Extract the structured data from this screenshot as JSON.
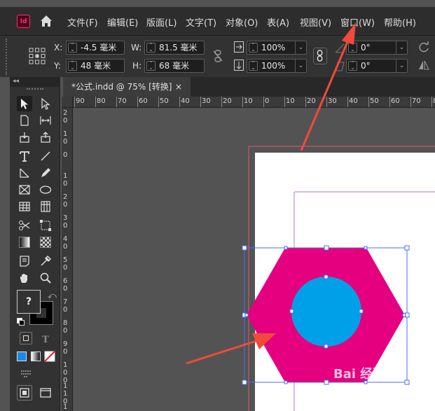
{
  "menubar": {
    "app_logo": "Id",
    "items": [
      "文件(F)",
      "编辑(E)",
      "版面(L)",
      "文字(T)",
      "对象(O)",
      "表(A)",
      "视图(V)",
      "窗口(W)",
      "帮助(H)"
    ]
  },
  "control": {
    "x_label": "X:",
    "x_value": "-4.5 毫米",
    "y_label": "Y:",
    "y_value": "48 毫米",
    "w_label": "W:",
    "w_value": "81.5 毫米",
    "h_label": "H:",
    "h_value": "68 毫米",
    "scale_x": "100%",
    "scale_y": "100%",
    "rotate": "0°",
    "shear": "0°"
  },
  "document_tab": {
    "title": "*公式.indd @ 75% [转换]",
    "close": "×"
  },
  "ruler": {
    "h_ticks": [
      "90",
      "80",
      "70",
      "60",
      "50",
      "40",
      "30",
      "20",
      "10",
      "0",
      "10",
      "20",
      "30",
      "40",
      "50",
      "60",
      "70",
      "80"
    ],
    "v_ticks": [
      "2 0",
      "1 0",
      "0",
      "1 0",
      "2 0",
      "3 0",
      "4 0",
      "5 0",
      "6 0",
      "7 0",
      "8 0",
      "9 0",
      "1 0 0",
      "1 1 0",
      "1 2 0"
    ]
  },
  "tools": {
    "fill_stroke_unknown": "?",
    "panel_collapse": "◂◂"
  },
  "icons": [
    "home-icon",
    "selection-icon",
    "direct-selection-icon",
    "page-icon",
    "gap-icon",
    "content-collector-icon",
    "content-placer-icon",
    "type-icon",
    "line-icon",
    "pen-icon",
    "pencil-icon",
    "rectangle-frame-icon",
    "ellipse-icon",
    "table-icon",
    "grid-icon",
    "scissors-icon",
    "free-transform-icon",
    "gradient-swatch-icon",
    "gradient-feather-icon",
    "note-icon",
    "eyedropper-icon",
    "hand-icon",
    "zoom-icon"
  ],
  "colors": {
    "hexagon": "#e4007f",
    "circle": "#00a0e9",
    "bleed": "#e05a6a",
    "margin": "#b070d0",
    "selection": "#4a6cf7",
    "arrow": "#f04a3a"
  },
  "watermark": "Bai 经验 jingyan.baidu.com"
}
